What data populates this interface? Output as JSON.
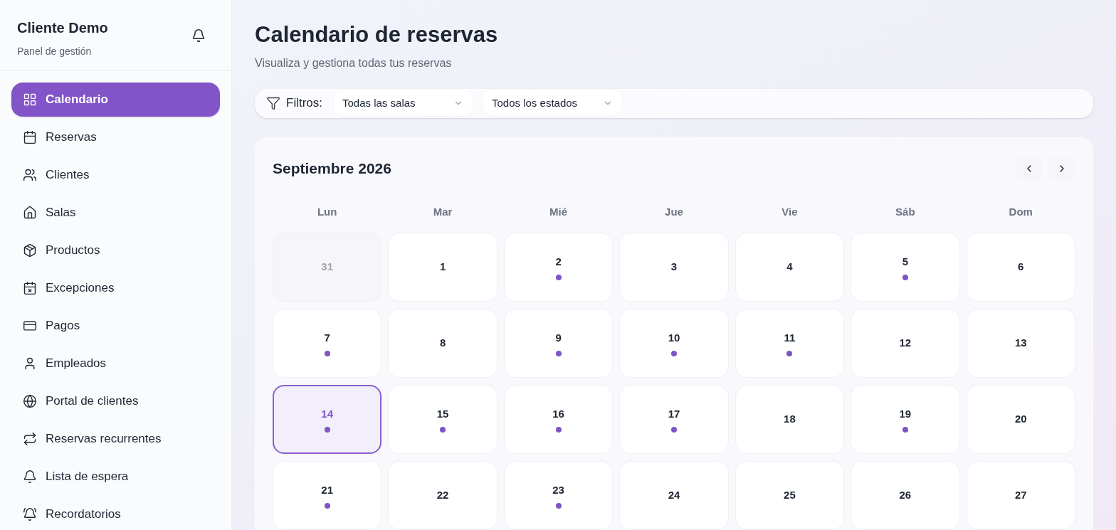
{
  "sidebar": {
    "title": "Cliente Demo",
    "subtitle": "Panel de gestión",
    "items": [
      {
        "label": "Calendario",
        "selected": true
      },
      {
        "label": "Reservas",
        "selected": false
      },
      {
        "label": "Clientes",
        "selected": false
      },
      {
        "label": "Salas",
        "selected": false
      },
      {
        "label": "Productos",
        "selected": false
      },
      {
        "label": "Excepciones",
        "selected": false
      },
      {
        "label": "Pagos",
        "selected": false
      },
      {
        "label": "Empleados",
        "selected": false
      },
      {
        "label": "Portal de clientes",
        "selected": false
      },
      {
        "label": "Reservas recurrentes",
        "selected": false
      },
      {
        "label": "Lista de espera",
        "selected": false
      },
      {
        "label": "Recordatorios",
        "selected": false
      }
    ]
  },
  "header": {
    "title": "Calendario de reservas",
    "subtitle": "Visualiza y gestiona todas tus reservas"
  },
  "filters": {
    "label": "Filtros:",
    "selects": [
      {
        "value": "Todas las salas"
      },
      {
        "value": "Todos los estados"
      }
    ]
  },
  "calendar": {
    "month": "Septiembre 2026",
    "weekdays": [
      "Lun",
      "Mar",
      "Mié",
      "Jue",
      "Vie",
      "Sáb",
      "Dom"
    ],
    "days": [
      {
        "label": "31",
        "outside": true,
        "selected": false,
        "booked": false
      },
      {
        "label": "1",
        "outside": false,
        "selected": false,
        "booked": false
      },
      {
        "label": "2",
        "outside": false,
        "selected": false,
        "booked": true
      },
      {
        "label": "3",
        "outside": false,
        "selected": false,
        "booked": false
      },
      {
        "label": "4",
        "outside": false,
        "selected": false,
        "booked": false
      },
      {
        "label": "5",
        "outside": false,
        "selected": false,
        "booked": true
      },
      {
        "label": "6",
        "outside": false,
        "selected": false,
        "booked": false
      },
      {
        "label": "7",
        "outside": false,
        "selected": false,
        "booked": true
      },
      {
        "label": "8",
        "outside": false,
        "selected": false,
        "booked": false
      },
      {
        "label": "9",
        "outside": false,
        "selected": false,
        "booked": true
      },
      {
        "label": "10",
        "outside": false,
        "selected": false,
        "booked": true
      },
      {
        "label": "11",
        "outside": false,
        "selected": false,
        "booked": true
      },
      {
        "label": "12",
        "outside": false,
        "selected": false,
        "booked": false
      },
      {
        "label": "13",
        "outside": false,
        "selected": false,
        "booked": false
      },
      {
        "label": "14",
        "outside": false,
        "selected": true,
        "booked": true
      },
      {
        "label": "15",
        "outside": false,
        "selected": false,
        "booked": true
      },
      {
        "label": "16",
        "outside": false,
        "selected": false,
        "booked": true
      },
      {
        "label": "17",
        "outside": false,
        "selected": false,
        "booked": true
      },
      {
        "label": "18",
        "outside": false,
        "selected": false,
        "booked": false
      },
      {
        "label": "19",
        "outside": false,
        "selected": false,
        "booked": true
      },
      {
        "label": "20",
        "outside": false,
        "selected": false,
        "booked": false
      },
      {
        "label": "21",
        "outside": false,
        "selected": false,
        "booked": true
      },
      {
        "label": "22",
        "outside": false,
        "selected": false,
        "booked": false
      },
      {
        "label": "23",
        "outside": false,
        "selected": false,
        "booked": true
      },
      {
        "label": "24",
        "outside": false,
        "selected": false,
        "booked": false
      },
      {
        "label": "25",
        "outside": false,
        "selected": false,
        "booked": false
      },
      {
        "label": "26",
        "outside": false,
        "selected": false,
        "booked": false
      },
      {
        "label": "27",
        "outside": false,
        "selected": false,
        "booked": false
      }
    ]
  }
}
